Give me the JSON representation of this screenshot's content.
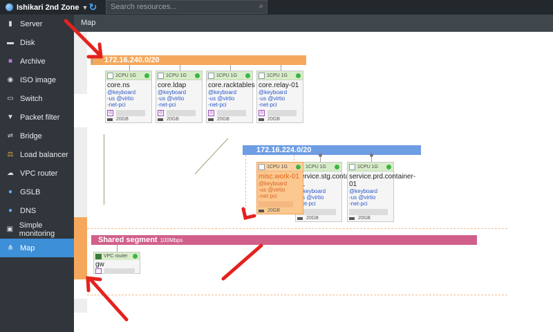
{
  "topbar": {
    "zone_label": "Ishikari 2nd Zone",
    "search_placeholder": "Search resources..."
  },
  "sidebar": {
    "items": [
      {
        "label": "Server",
        "icon": "server-icon",
        "active": false
      },
      {
        "label": "Disk",
        "icon": "disk-icon",
        "active": false
      },
      {
        "label": "Archive",
        "icon": "archive-icon",
        "active": false
      },
      {
        "label": "ISO image",
        "icon": "iso-icon",
        "active": false
      },
      {
        "label": "Switch",
        "icon": "switch-icon",
        "active": false
      },
      {
        "label": "Packet filter",
        "icon": "filter-icon",
        "active": false
      },
      {
        "label": "Bridge",
        "icon": "bridge-icon",
        "active": false
      },
      {
        "label": "Load balancer",
        "icon": "load-balancer-icon",
        "active": false
      },
      {
        "label": "VPC router",
        "icon": "vpc-router-icon",
        "active": false
      },
      {
        "label": "GSLB",
        "icon": "gslb-icon",
        "active": false
      },
      {
        "label": "DNS",
        "icon": "dns-icon",
        "active": false
      },
      {
        "label": "Simple monitoring",
        "icon": "monitoring-icon",
        "active": false
      },
      {
        "label": "Map",
        "icon": "map-icon",
        "active": true
      }
    ]
  },
  "main": {
    "title": "Map"
  },
  "segments": {
    "a": "172.16.240.0/20",
    "b": "172.16.224.0/20",
    "shared": "Shared segment",
    "shared_bw": "100Mbps"
  },
  "servers": [
    {
      "spec": "1CPU 1G",
      "name": "core.ns",
      "tags": [
        "@keyboard",
        "-us  @virtio",
        "-net-pci"
      ],
      "disk": "20GB"
    },
    {
      "spec": "1CPU 1G",
      "name": "core.ldap",
      "tags": [
        "@keyboard",
        "-us  @virtio",
        "-net-pci"
      ],
      "disk": "20GB"
    },
    {
      "spec": "1CPU 1G",
      "name": "core.racktables",
      "tags": [
        "@keyboard",
        "-us  @virtio",
        "-net-pci"
      ],
      "disk": "20GB"
    },
    {
      "spec": "1CPU 1G",
      "name": "core.relay-01",
      "tags": [
        "@keyboard",
        "-us  @virtio",
        "-net-pci"
      ],
      "disk": "20GB"
    },
    {
      "spec": "1CPU 1G",
      "name": "misc.work-01",
      "tags": [
        "@keyboard",
        "-us  @virtio",
        "-net-pci"
      ],
      "disk": "20GB"
    },
    {
      "spec": "1CPU 1G",
      "name": "service.stg.container-01",
      "tags": [
        "@keyboard",
        "-us  @virtio",
        "-net-pci"
      ],
      "disk": "20GB"
    },
    {
      "spec": "1CPU 1G",
      "name": "service.prd.container-01",
      "tags": [
        "@keyboard",
        "-us  @virtio",
        "-net-pci"
      ],
      "disk": "20GB"
    }
  ],
  "router": {
    "spec": "VPC router",
    "name": "gw"
  },
  "colors": {
    "accent": "#3d8fd8",
    "segment_a": "#f5a85c",
    "segment_b": "#6d9de3",
    "segment_shared": "#d05f8a",
    "status_ok": "#3cb544"
  }
}
